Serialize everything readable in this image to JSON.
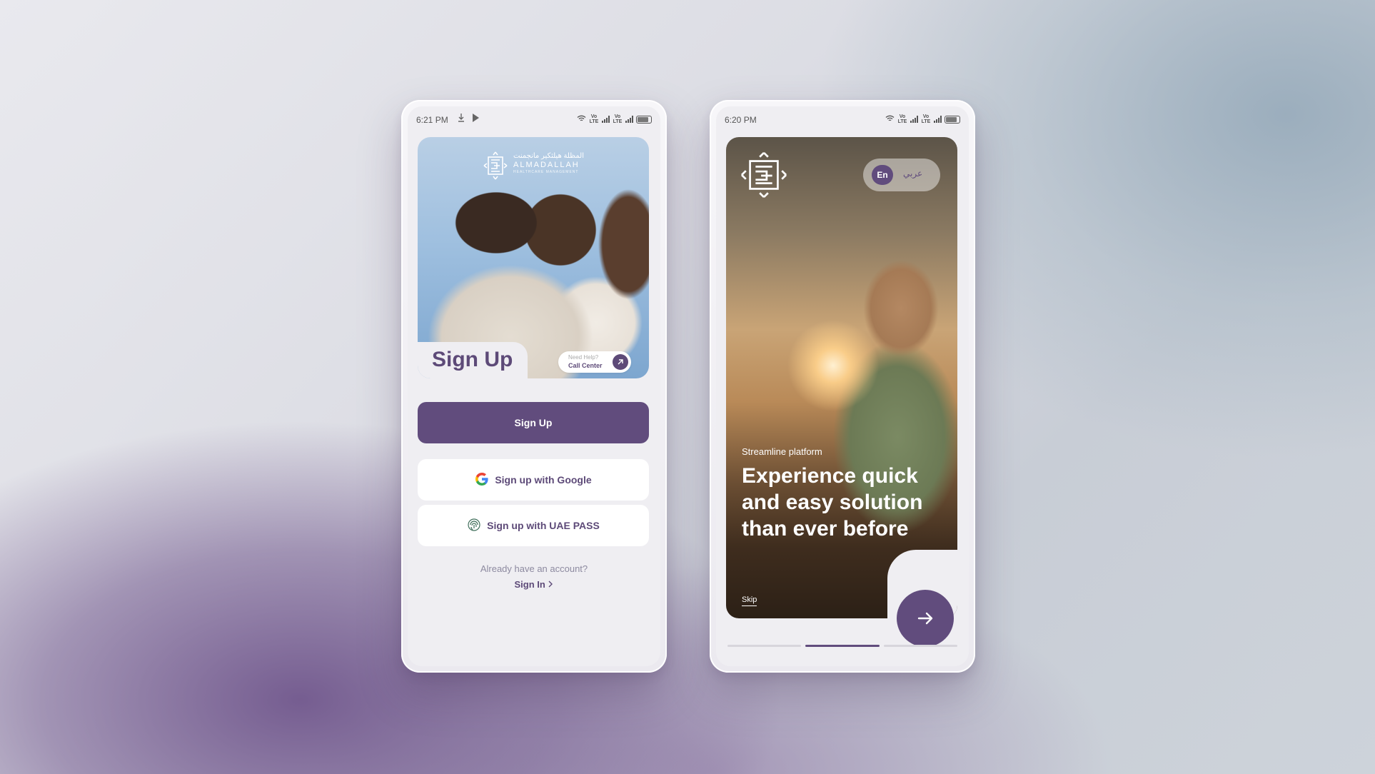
{
  "colors": {
    "primary": "#614c7d",
    "title_text": "#5d4a78",
    "muted_text": "#8d8aa0",
    "screen_bg": "#efeef2"
  },
  "signup_screen": {
    "status_time": "6:21 PM",
    "status_icons": [
      "download-icon",
      "play-store-icon",
      "wifi-icon",
      "volte-icon",
      "signal-icon",
      "volte-icon",
      "signal-icon",
      "battery-icon"
    ],
    "brand": {
      "name_arabic": "المظلة هيلثكير مانجمنت",
      "name": "ALMADALLAH",
      "tagline": "HEALTHCARE MANAGEMENT"
    },
    "title": "Sign Up",
    "help": {
      "line1": "Need Help?",
      "line2": "Call Center",
      "icon": "arrow-up-right-icon"
    },
    "primary_button": "Sign Up",
    "google_button": "Sign up with Google",
    "uae_pass_button": "Sign up with UAE PASS",
    "already_text": "Already have an account?",
    "sign_in_link": "Sign In",
    "sign_in_icon": "chevron-right-icon"
  },
  "onboarding_screen": {
    "status_time": "6:20 PM",
    "language": {
      "selected": "En",
      "other": "عربي"
    },
    "kicker": "Streamline platform",
    "headline": "Experience quick and easy solution than ever before",
    "skip": "Skip",
    "next_icon": "arrow-right-icon",
    "progress": {
      "steps": 3,
      "active_step": 2
    }
  }
}
